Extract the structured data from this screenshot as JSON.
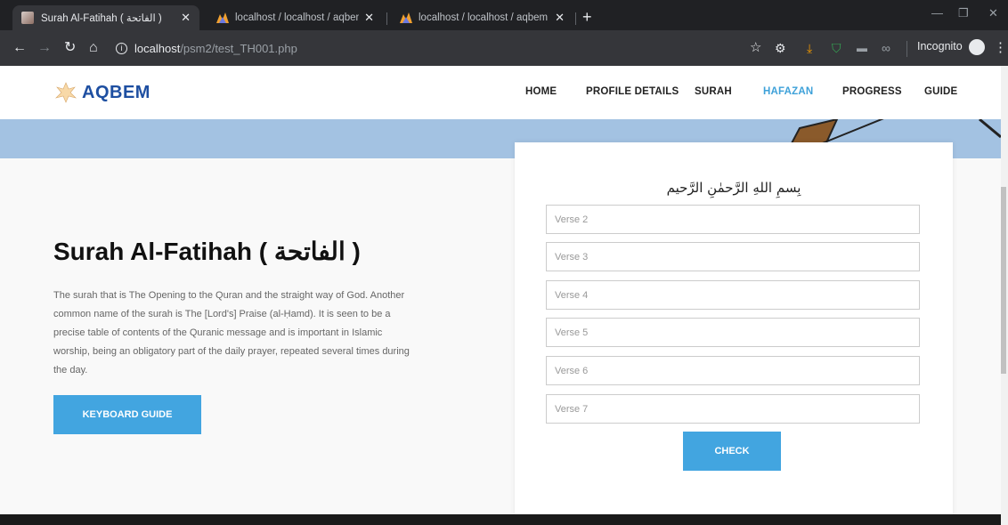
{
  "browser": {
    "tabs": [
      {
        "title": "Surah Al-Fatihah ( الفاتحة )",
        "active": true
      },
      {
        "title": "localhost / localhost / aqbem / su",
        "active": false
      },
      {
        "title": "localhost / localhost / aqbem / su",
        "active": false
      }
    ],
    "url_host": "localhost",
    "url_path": "/psm2/test_TH001.php",
    "incognito_label": "Incognito"
  },
  "nav": {
    "logo_text": "AQBEM",
    "items": [
      "HOME",
      "PROFILE DETAILS",
      "SURAH",
      "HAFAZAN",
      "PROGRESS",
      "GUIDE"
    ],
    "active": "HAFAZAN"
  },
  "main": {
    "title": "Surah Al-Fatihah ( الفاتحة )",
    "description": "The surah that is The Opening to the Quran and the straight way of God. Another common name of the surah is The [Lord's] Praise (al-Ḥamd). It is seen to be a precise table of contents of the Quranic message and is important in Islamic worship, being an obligatory part of the daily prayer, repeated several times during the day.",
    "keyboard_button": "KEYBOARD GUIDE"
  },
  "form": {
    "basmala": "بِسمِ اللهِ الرَّحمٰنِ الرَّحيم",
    "verses": [
      {
        "placeholder": "Verse 2",
        "value": ""
      },
      {
        "placeholder": "Verse 3",
        "value": ""
      },
      {
        "placeholder": "Verse 4",
        "value": ""
      },
      {
        "placeholder": "Verse 5",
        "value": ""
      },
      {
        "placeholder": "Verse 6",
        "value": ""
      },
      {
        "placeholder": "Verse 7",
        "value": ""
      }
    ],
    "check_button": "CHECK"
  },
  "colors": {
    "accent": "#42a5e0",
    "hero_band": "#a3c2e2",
    "logo": "#1e4fa1",
    "chrome_dark": "#202124"
  },
  "icons": [
    "back-icon",
    "forward-icon",
    "reload-icon",
    "home-icon",
    "info-icon",
    "star-icon",
    "download-icon",
    "shield-icon",
    "incognito-icon",
    "menu-icon"
  ]
}
